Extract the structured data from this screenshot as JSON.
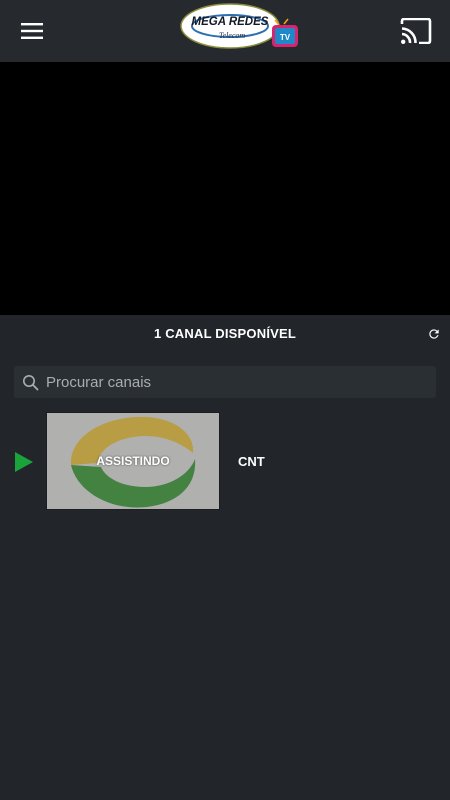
{
  "app": {
    "logo_text": "MEGA REDES",
    "logo_subtext": "Telecom",
    "logo_badge": "TV"
  },
  "header": {
    "menu_icon": "hamburger-menu-icon",
    "cast_icon": "cast-icon"
  },
  "channels": {
    "count_label": "1 CANAL DISPONÍVEL",
    "refresh_icon": "refresh-icon",
    "search": {
      "placeholder": "Procurar canais",
      "value": ""
    },
    "items": [
      {
        "name": "CNT",
        "status": "ASSISTINDO",
        "playing": true
      }
    ]
  },
  "colors": {
    "background": "#22262a",
    "topbar": "#262a2e",
    "player": "#000000",
    "accent_play": "#1aa33b",
    "text": "#ffffff",
    "placeholder": "#a9adb1"
  }
}
